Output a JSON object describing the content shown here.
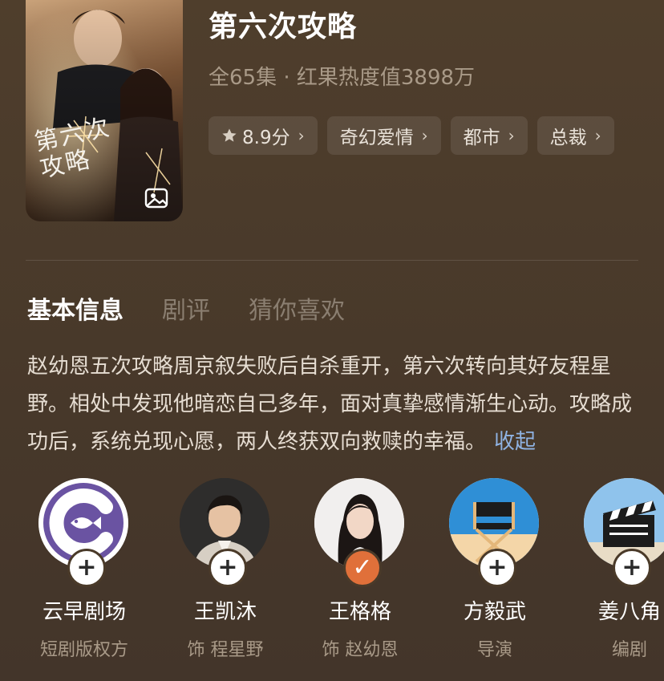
{
  "show": {
    "title": "第六次攻略",
    "meta": "全65集 · 红果热度值3898万",
    "poster_text": "第六次攻略"
  },
  "tags": [
    {
      "label": "8.9分",
      "icon": "star-icon"
    },
    {
      "label": "奇幻爱情",
      "icon": "chevron-right-icon"
    },
    {
      "label": "都市",
      "icon": "chevron-right-icon"
    },
    {
      "label": "总裁",
      "icon": "chevron-right-icon"
    }
  ],
  "tabs": [
    {
      "label": "基本信息",
      "active": true
    },
    {
      "label": "剧评",
      "active": false
    },
    {
      "label": "猜你喜欢",
      "active": false
    }
  ],
  "description": {
    "text": "赵幼恩五次攻略周京叙失败后自杀重开，第六次转向其好友程星野。相处中发现他暗恋自己多年，面对真挚感情渐生心动。攻略成功后，系统兑现心愿，两人终获双向救赎的幸福。",
    "toggle": "收起"
  },
  "people": [
    {
      "name": "云早剧场",
      "role": "短剧版权方",
      "followed": false,
      "avatar": "fish-logo-icon",
      "follow_symbol": "+"
    },
    {
      "name": "王凯沐",
      "role": "饰 程星野",
      "followed": false,
      "avatar": "person-photo",
      "follow_symbol": "+"
    },
    {
      "name": "王格格",
      "role": "饰 赵幼恩",
      "followed": true,
      "avatar": "person-photo",
      "follow_symbol": "✓"
    },
    {
      "name": "方毅武",
      "role": "导演",
      "followed": false,
      "avatar": "director-chair-icon",
      "follow_symbol": "+"
    },
    {
      "name": "姜八角",
      "role": "编剧",
      "followed": false,
      "avatar": "clapperboard-icon",
      "follow_symbol": "+"
    }
  ],
  "colors": {
    "background": "#4a3a29",
    "accent_link": "#8fb3e3",
    "followed_badge": "#e0703a",
    "muted_text": "#a99a88"
  }
}
